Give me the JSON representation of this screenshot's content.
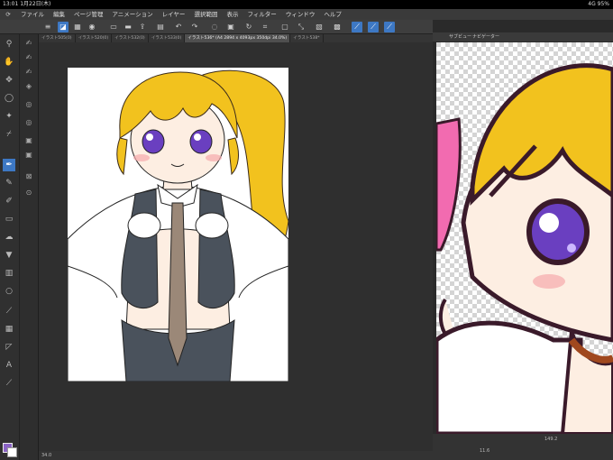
{
  "status": {
    "time": "13:01",
    "date": "1月22日(木)",
    "battery": "4G 95%"
  },
  "menu": [
    "ファイル",
    "編集",
    "ページ管理",
    "アニメーション",
    "レイヤー",
    "選択範囲",
    "表示",
    "フィルター",
    "ウィンドウ",
    "ヘルプ"
  ],
  "tabs": [
    {
      "label": "イラスト505(0)",
      "active": false
    },
    {
      "label": "イラスト520(0)",
      "active": false
    },
    {
      "label": "イラスト532(0)",
      "active": false
    },
    {
      "label": "イラスト533(0)",
      "active": false
    },
    {
      "label": "イラスト536* (A4 2894 x 4093px 350dpi 34.0%)",
      "active": true
    },
    {
      "label": "イラスト538*",
      "active": false
    }
  ],
  "canvas": {
    "zoom": "34.0"
  },
  "subview": {
    "header_label": "サブビュー",
    "tab2": "ナビゲーター",
    "value1": "149.2",
    "value2": "11.6"
  },
  "colors": {
    "foreground": "#8a63c4",
    "accent": "#3d78c4"
  }
}
